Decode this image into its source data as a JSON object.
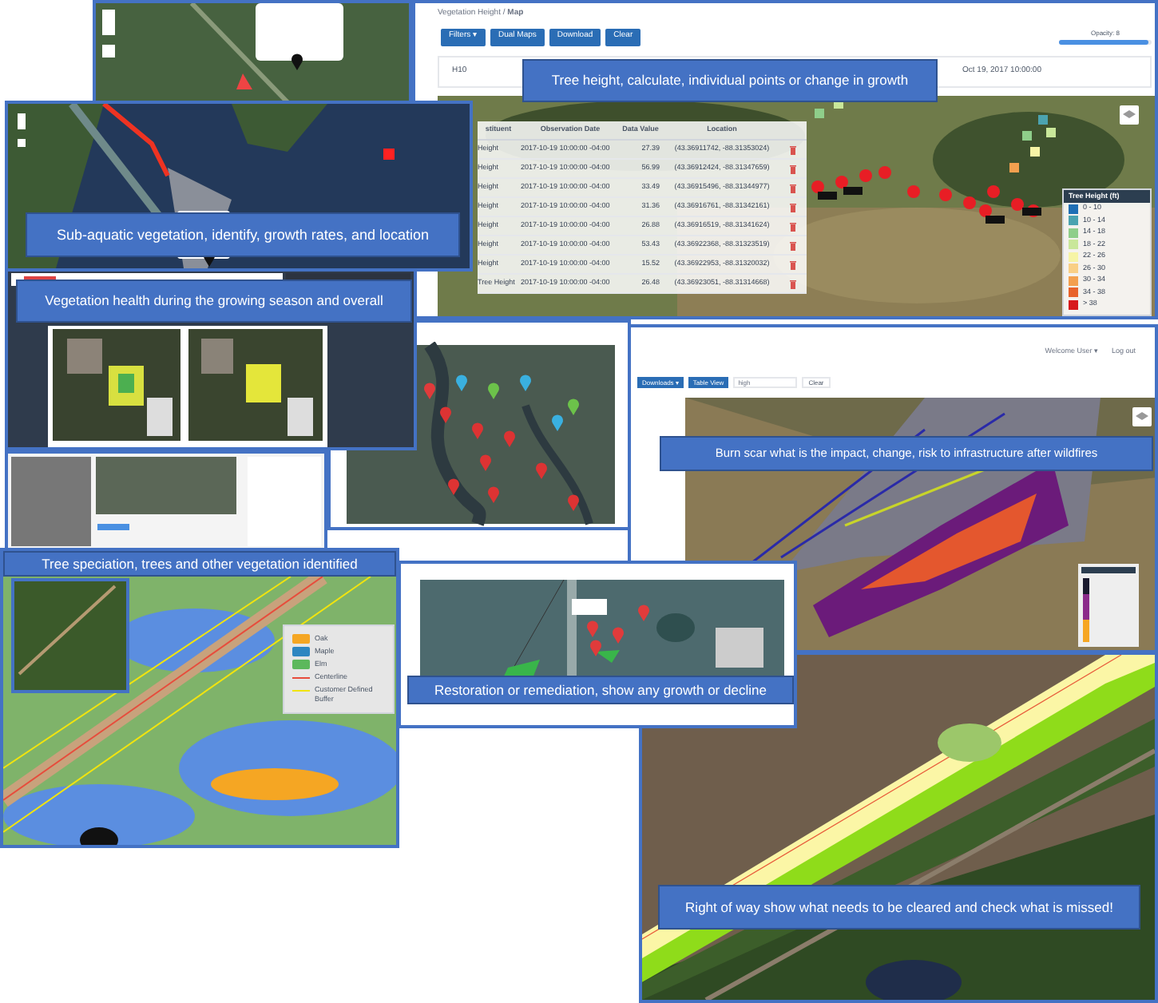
{
  "panels": [
    {
      "kind": "city_map"
    },
    {
      "kind": "aquatic_top"
    },
    {
      "kind": "tree_height",
      "breadcrumb": "Vegetation Height / **Map**",
      "buttons": [
        {
          "label": "Filters ▾"
        },
        {
          "label": "Dual Maps"
        },
        {
          "label": "Download"
        },
        {
          "label": "Clear"
        }
      ],
      "opacity_label": "Opacity: 8",
      "opacity": {
        "level": 0.97
      },
      "layer_field": "H10",
      "date_field": "Oct 19, 2017 10:00:00",
      "caption": "Tree height, calculate, individual  points or change in growth",
      "table": {
        "columns": [
          "stituent",
          "Observation Date",
          "Data Value",
          "Location"
        ],
        "rows": [
          {
            "cells": [
              "Height",
              "2017-10-19 10:00:00 -04:00",
              "27.39",
              "(43.36911742, -88.31353024)"
            ]
          },
          {
            "cells": [
              "Height",
              "2017-10-19 10:00:00 -04:00",
              "56.99",
              "(43.36912424, -88.31347659)"
            ]
          },
          {
            "cells": [
              "Height",
              "2017-10-19 10:00:00 -04:00",
              "33.49",
              "(43.36915496, -88.31344977)"
            ]
          },
          {
            "cells": [
              "Height",
              "2017-10-19 10:00:00 -04:00",
              "31.36",
              "(43.36916761, -88.31342161)"
            ]
          },
          {
            "cells": [
              "Height",
              "2017-10-19 10:00:00 -04:00",
              "26.88",
              "(43.36916519, -88.31341624)"
            ]
          },
          {
            "cells": [
              "Height",
              "2017-10-19 10:00:00 -04:00",
              "53.43",
              "(43.36922368, -88.31323519)"
            ]
          },
          {
            "cells": [
              "Height",
              "2017-10-19 10:00:00 -04:00",
              "15.52",
              "(43.36922953, -88.31320032)"
            ]
          },
          {
            "cells": [
              "Tree Height",
              "2017-10-19 10:00:00 -04:00",
              "26.48",
              "(43.36923051, -88.31314668)"
            ]
          }
        ]
      },
      "legend": {
        "title": "Tree Height (ft)",
        "items": [
          {
            "label": "0 - 10",
            "color": "#1f6fb5"
          },
          {
            "label": "10 - 14",
            "color": "#4ba3b0"
          },
          {
            "label": "14 - 18",
            "color": "#8fce8a"
          },
          {
            "label": "18 - 22",
            "color": "#c9e79a"
          },
          {
            "label": "22 - 26",
            "color": "#f6f4a6"
          },
          {
            "label": "26 - 30",
            "color": "#f9cf85"
          },
          {
            "label": "30 - 34",
            "color": "#f3a04f"
          },
          {
            "label": "34 - 38",
            "color": "#e8632c"
          },
          {
            "label": "> 38",
            "color": "#d7191c"
          }
        ]
      }
    },
    {
      "kind": "sub_aquatic",
      "caption": "Sub-aquatic vegetation, identify, growth rates, and location"
    },
    {
      "kind": "veg_health",
      "caption": "Vegetation health during the growing season and overall"
    },
    {
      "kind": "app_block"
    },
    {
      "kind": "burn_scar",
      "user_menu": "Welcome User ▾",
      "logout": "Log out",
      "buttons": [
        {
          "label": "Downloads ▾"
        },
        {
          "label": "Table View"
        }
      ],
      "search_value": "high",
      "clear_label": "Clear",
      "caption": "Burn scar what is the impact, change, risk to infrastructure after wildfires"
    },
    {
      "kind": "speciation",
      "caption": "Tree speciation, trees and other vegetation identified",
      "legend": [
        {
          "kind": "swatch",
          "label": "Oak",
          "color": "#f5a623"
        },
        {
          "kind": "swatch",
          "label": "Maple",
          "color": "#2e86c1"
        },
        {
          "kind": "swatch",
          "label": "Elm",
          "color": "#5cb85c"
        },
        {
          "kind": "line",
          "label": "Centerline",
          "color": "#e74c3c"
        },
        {
          "kind": "line",
          "label": "Customer Defined Buffer",
          "color": "#f1e40f"
        }
      ]
    },
    {
      "kind": "right_of_way",
      "caption": "Right of way show what needs to be cleared and check what is missed!"
    },
    {
      "kind": "restoration",
      "caption": "Restoration or remediation, show any growth or decline"
    }
  ]
}
